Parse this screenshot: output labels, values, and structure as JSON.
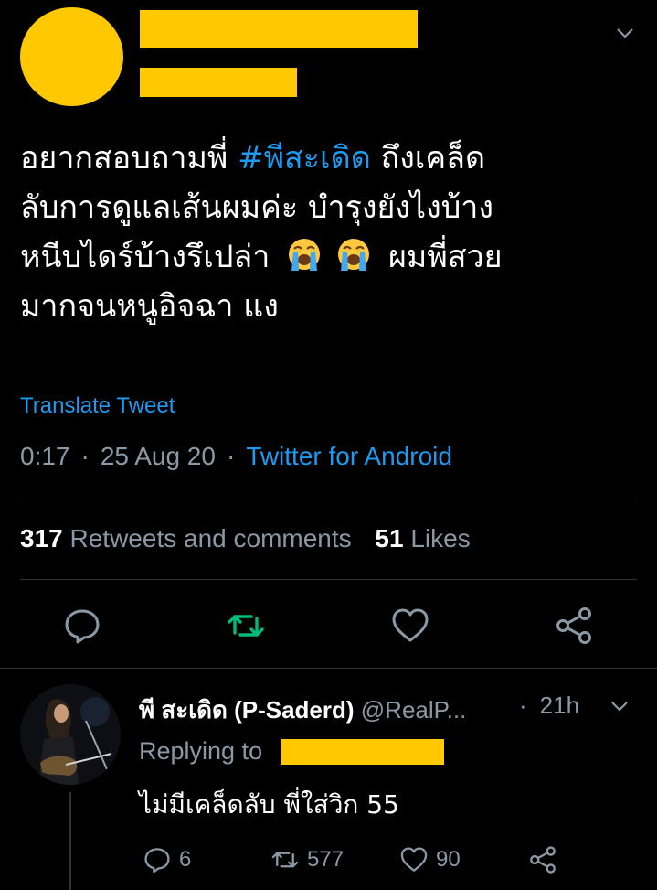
{
  "tweet": {
    "text_before_tag": "อยากสอบถามพี่ ",
    "hashtag": "#พีสะเดิด",
    "text_line1_end": " ถึงเคล็ด",
    "text_line2": "ลับการดูแลเส้นผมค่ะ บำรุงยังไงบ้าง",
    "text_line3_start": "หนีบไดร์บ้างรึเปล่า",
    "text_line3_end": "ผมพี่สวย",
    "text_line4": "มากจนหนูอิจฉา แง",
    "emoji_icons": [
      "loudly-crying-face-icon",
      "loudly-crying-face-icon"
    ],
    "translate_label": "Translate Tweet",
    "time": "0:17",
    "date": "25 Aug 20",
    "source": "Twitter for Android",
    "retweets_count": "317",
    "retweets_label": "Retweets and comments",
    "likes_count": "51",
    "likes_label": "Likes"
  },
  "colors": {
    "background": "#000000",
    "accent": "#1D9BF0",
    "retweet_active": "#00BA7C",
    "muted": "#8B98A5",
    "redaction": "#FFC800"
  },
  "reply": {
    "name": "พี สะเดิด (P-Saderd)",
    "handle": "@RealP...",
    "time": "21h",
    "replying_label": "Replying to",
    "text": "ไม่มีเคล็ดลับ พี่ใส่วิก 55",
    "reply_count": "6",
    "retweet_count": "577",
    "like_count": "90"
  }
}
